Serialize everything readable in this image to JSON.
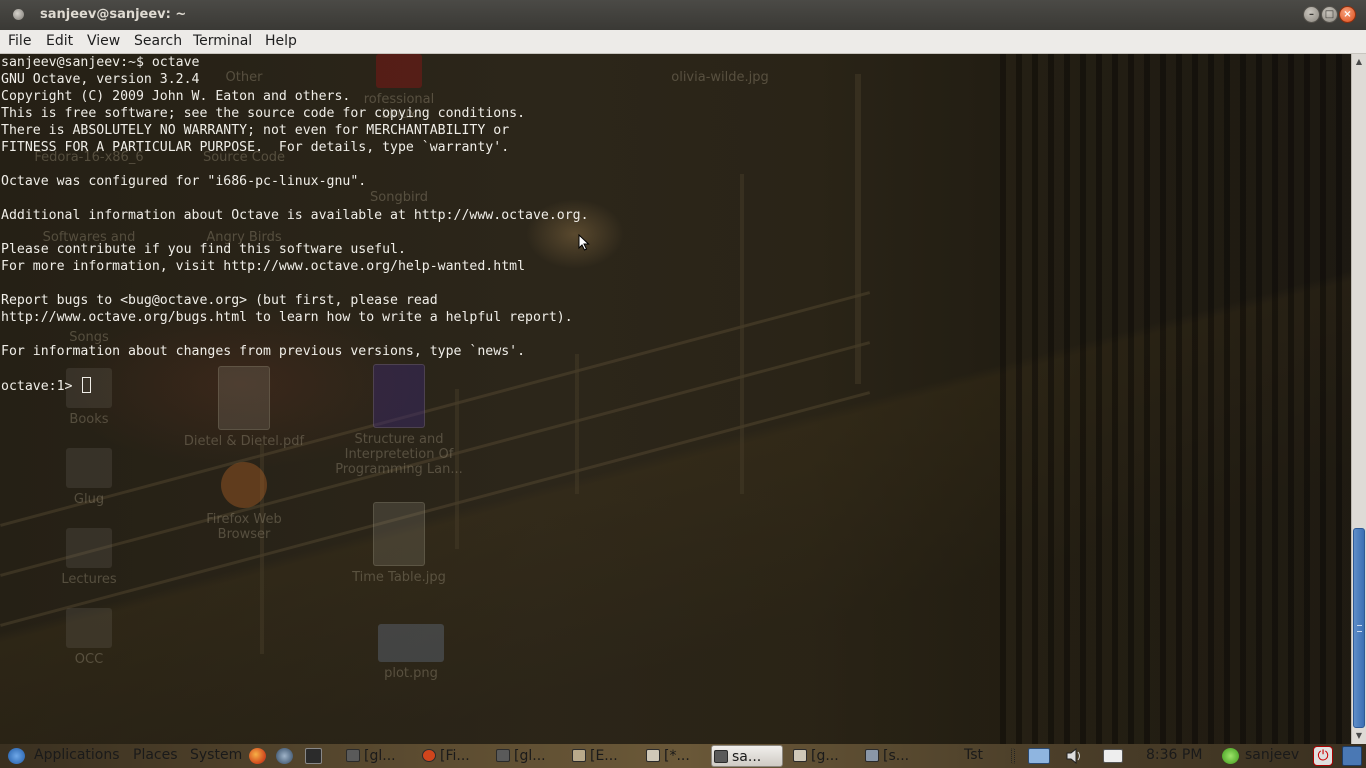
{
  "window": {
    "title": "sanjeev@sanjeev: ~",
    "controls": {
      "minimize": "–",
      "maximize": "□",
      "close": "×"
    }
  },
  "menubar": {
    "items": [
      {
        "label": "File"
      },
      {
        "label": "Edit"
      },
      {
        "label": "View"
      },
      {
        "label": "Search"
      },
      {
        "label": "Terminal"
      },
      {
        "label": "Help"
      }
    ]
  },
  "terminal": {
    "output": "sanjeev@sanjeev:~$ octave\nGNU Octave, version 3.2.4\nCopyright (C) 2009 John W. Eaton and others.\nThis is free software; see the source code for copying conditions.\nThere is ABSOLUTELY NO WARRANTY; not even for MERCHANTABILITY or\nFITNESS FOR A PARTICULAR PURPOSE.  For details, type `warranty'.\n\nOctave was configured for \"i686-pc-linux-gnu\".\n\nAdditional information about Octave is available at http://www.octave.org.\n\nPlease contribute if you find this software useful.\nFor more information, visit http://www.octave.org/help-wanted.html\n\nReport bugs to <bug@octave.org> (but first, please read\nhttp://www.octave.org/bugs.html to learn how to write a helpful report).\n\nFor information about changes from previous versions, type `news'.",
    "prompt": "octave:1> "
  },
  "desktop_icons": [
    {
      "label": "Other"
    },
    {
      "label": "rofessional Linux"
    },
    {
      "label": "olivia-wilde.jpg"
    },
    {
      "label": "Fedora-16-x86_6"
    },
    {
      "label": "Source Code"
    },
    {
      "label": "Songbird"
    },
    {
      "label": "Softwares and"
    },
    {
      "label": "Angry Birds"
    },
    {
      "label": "Songs"
    },
    {
      "label": "Books"
    },
    {
      "label": "Dietel & Dietel.pdf"
    },
    {
      "label": "Structure and Interpretetion Of Programming Lan..."
    },
    {
      "label": "Glug"
    },
    {
      "label": "Firefox Web Browser"
    },
    {
      "label": "Lectures"
    },
    {
      "label": "Time Table.jpg"
    },
    {
      "label": "OCC"
    },
    {
      "label": "plot.png"
    }
  ],
  "panel": {
    "menus": [
      {
        "label": "Applications"
      },
      {
        "label": "Places"
      },
      {
        "label": "System"
      }
    ],
    "tasks": [
      {
        "label": "[gl...",
        "active": false
      },
      {
        "label": "[Fi...",
        "active": false
      },
      {
        "label": "[gl...",
        "active": false
      },
      {
        "label": "[E...",
        "active": false
      },
      {
        "label": "[*...",
        "active": false
      },
      {
        "label": "sa...",
        "active": true
      },
      {
        "label": "[g...",
        "active": false
      },
      {
        "label": "[s...",
        "active": false
      }
    ],
    "tray_text": "Tst",
    "clock": "8:36 PM",
    "user": "sanjeev"
  },
  "colors": {
    "terminal_text": "#f0eee8",
    "close_button": "#de4a17",
    "scroll_thumb": "#3b6fb4"
  }
}
